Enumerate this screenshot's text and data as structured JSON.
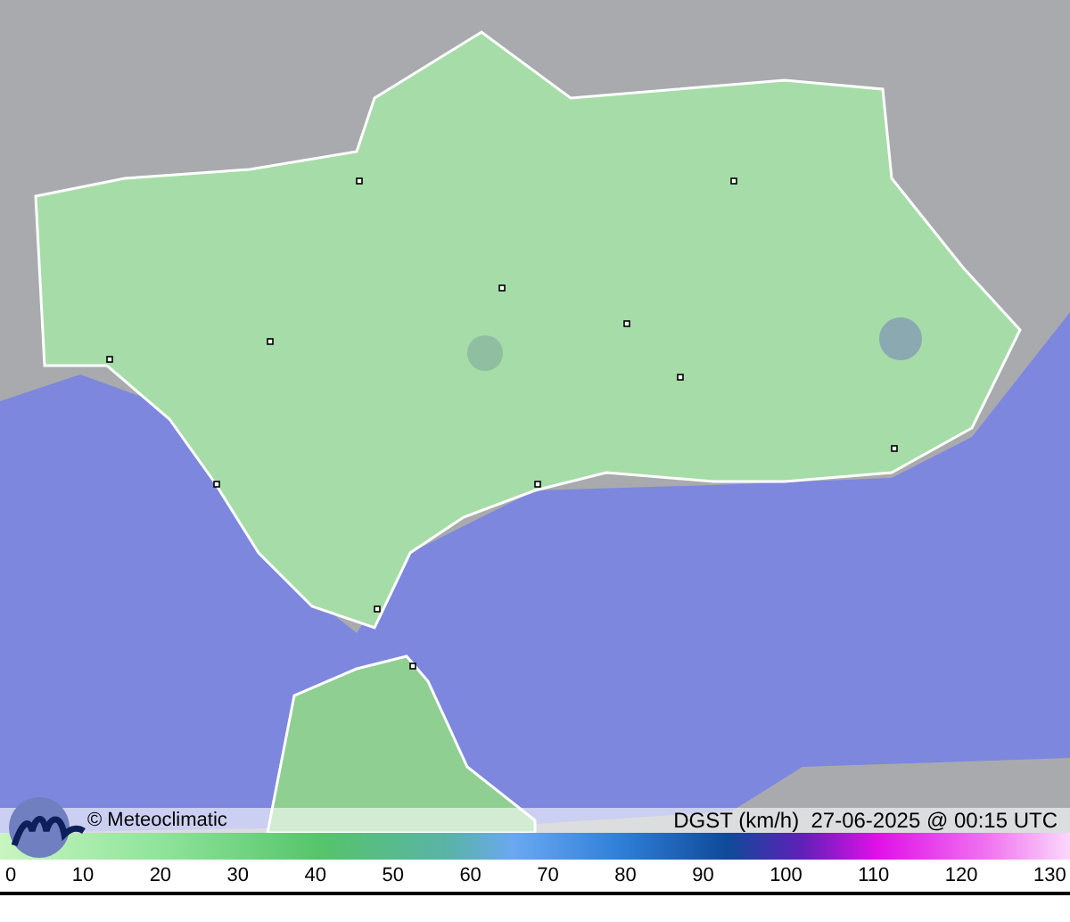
{
  "map": {
    "credit": "© Meteoclimatic",
    "caption": "DGST (km/h)  27-06-2025 @ 00:15 UTC"
  },
  "legend": {
    "ticks": [
      "0",
      "10",
      "20",
      "30",
      "40",
      "50",
      "60",
      "70",
      "80",
      "90",
      "100",
      "110",
      "120",
      "130"
    ]
  }
}
